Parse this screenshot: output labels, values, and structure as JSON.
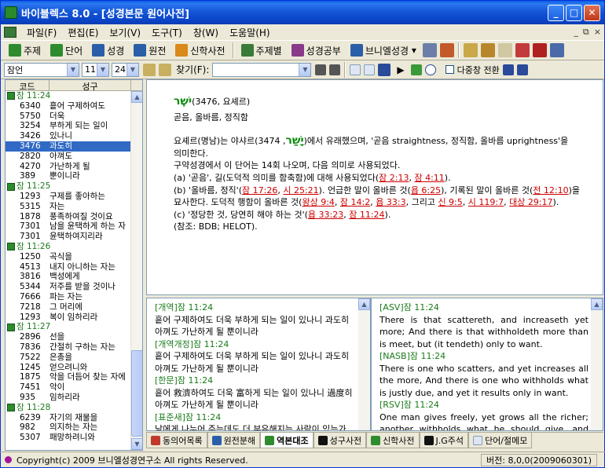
{
  "window": {
    "title": "바이블렉스 8.0 - [성경본문 원어사전]",
    "minimize": "_",
    "maximize": "□",
    "close": "✕"
  },
  "menu": {
    "items": [
      "파일(F)",
      "편집(E)",
      "보기(V)",
      "도구(T)",
      "창(W)",
      "도움말(H)"
    ],
    "mdi_min": "_",
    "mdi_restore": "⧉",
    "mdi_close": "×"
  },
  "toolbar": {
    "items": [
      "주제",
      "단어",
      "성경",
      "원전",
      "신학사전",
      "주제별",
      "성경공부",
      "브니엘성경"
    ]
  },
  "nav": {
    "book": "잠언",
    "chapter": "11",
    "verse": "24",
    "search_label": "찾기(F):",
    "search_value": "",
    "multiwindow_label": "다중창 전환"
  },
  "list": {
    "columns": [
      "코드",
      "성구"
    ],
    "groups": [
      {
        "ref": "잠 11:24",
        "rows": [
          [
            "6340",
            "흩어 구제하여도"
          ],
          [
            "5750",
            "더욱"
          ],
          [
            "3254",
            "부하게 되는 일이"
          ],
          [
            "3426",
            "있나니"
          ],
          [
            "3476",
            "과도히"
          ],
          [
            "2820",
            "아껴도"
          ],
          [
            "4270",
            "가난하게 될"
          ],
          [
            "389",
            "뿐이니라"
          ]
        ]
      },
      {
        "ref": "잠 11:25",
        "rows": [
          [
            "1293",
            "구제를 좋아하는"
          ],
          [
            "5315",
            "자는"
          ],
          [
            "1878",
            "풍족하여질 것이요"
          ],
          [
            "7301",
            "남을 윤택하게 하는 자"
          ],
          [
            "7301",
            "윤택하여지리라"
          ]
        ]
      },
      {
        "ref": "잠 11:26",
        "rows": [
          [
            "1250",
            "곡식을"
          ],
          [
            "4513",
            "내지 아니하는 자는"
          ],
          [
            "3816",
            "백성에게"
          ],
          [
            "5344",
            "저주를 받을 것이나"
          ],
          [
            "7666",
            "파는 자는"
          ],
          [
            "7218",
            "그 머리에"
          ],
          [
            "1293",
            "복이 임하리라"
          ]
        ]
      },
      {
        "ref": "잠 11:27",
        "rows": [
          [
            "2896",
            "선을"
          ],
          [
            "7836",
            "간절히 구하는 자는"
          ],
          [
            "7522",
            "은총을"
          ],
          [
            "1245",
            "얻으려니와"
          ],
          [
            "1875",
            "악을 더듬어 찾는 자에"
          ],
          [
            "7451",
            "악이"
          ],
          [
            "935",
            "임하리라"
          ]
        ]
      },
      {
        "ref": "잠 11:28",
        "rows": [
          [
            "6239",
            "자기의 재물을"
          ],
          [
            "982",
            "의지하는 자는"
          ],
          [
            "5307",
            "패망하려니와"
          ]
        ]
      }
    ],
    "selected": "3476"
  },
  "dict": {
    "heb": "ישֶׁר",
    "entry": "(3476, 요셰르)",
    "meaning": "곧음, 올바름, 정직함",
    "p1a": "요셰르(명남)는 야샤르(",
    "heb2": "יָשַׁר",
    "p1b": ", 3474)에서 유래했으며, '곧음 straightness, 정직함, 올바름 uprightness'을",
    "p1c": "의미한다.",
    "p2": "구약성경에서 이 단어는 14회 나오며, 다음 의미로 사용되었다.",
    "a_pre": "(a) '곧음', 길(도덕적 의미를 함축함)에 대해 사용되었다(",
    "a_r1": "잠 2:13",
    "a_sep": ", ",
    "a_r2": "잠 4:11",
    "a_post": ").",
    "b_pre": "(b) '올바름, 정직'(",
    "b_r1": "잠 17:26",
    "b_s1": ", ",
    "b_r2": "시 25:21",
    "b_mid": "). 언급한 말이 올바른 것(",
    "b_r3": "욥 6:25",
    "b_mid2": "), 기록된 말이 올바른 것(",
    "b_r4": "전 12:10",
    "b_post": ")을",
    "b2_pre": "묘사한다. 도덕적 행함이 올바른 것(",
    "b2_r1": "왕상 9:4",
    "b2_s1": ", ",
    "b2_r2": "잠 14:2",
    "b2_s2": ", ",
    "b2_r3": "욥 33:3",
    "b2_mid": ", 그리고 ",
    "b2_r4": "신 9:5",
    "b2_s3": ", ",
    "b2_r5": "시 119:7",
    "b2_s4": ", ",
    "b2_r6": "대상 29:17",
    "b2_post": ").",
    "c_pre": "(c) '정당한 것, 당연히 해야 하는 것'(",
    "c_r1": "욥 33:23",
    "c_sep": ", ",
    "c_r2": "잠 11:24",
    "c_post": ").",
    "ref": "(참조: BDB; HELOT)."
  },
  "kor": [
    {
      "label": "[개역]잠 11:24",
      "text": "흩어 구제하여도 더욱 부하게 되는 일이 있나니 과도히 아껴도 가난하게 될 뿐이니라"
    },
    {
      "label": "[개역개정]잠 11:24",
      "text": "흩어 구제하여도 더욱 부하게 되는 일이 있나니 과도히 아껴도 가난하게 될 뿐이니라"
    },
    {
      "label": "[한문]잠 11:24",
      "text": "흩어 救濟하여도 더욱 富하게 되는 일이 있나니 過度히 아껴도 가난하게 될 뿐이니라"
    },
    {
      "label": "[표준새]잠 11:24",
      "text": "남에게 나누어 주는데도 더 부유해지는 사람이 있는가 하면"
    }
  ],
  "eng": [
    {
      "label": "[ASV]잠 11:24",
      "text": "There is that scattereth, and increaseth yet more; And there is that withholdeth more than is meet, but (it tendeth) only to want."
    },
    {
      "label": "[NASB]잠 11:24",
      "text": "There is one who scatters, and yet increases all the more, And there is one who withholds what is justly due, and yet it results only in want."
    },
    {
      "label": "[RSV]잠 11:24",
      "text": "One man gives freely, yet grows all the richer; another withholds what he should give, and only"
    }
  ],
  "tabs": [
    "동의어목록",
    "원전분해",
    "역본대조",
    "성구사전",
    "신학사전",
    "J.G주석",
    "단어/절메모"
  ],
  "active_tab": "역본대조",
  "status": {
    "copyright": "Copyright(c) 2009 브니엘성경연구소 All rights Reserved.",
    "version": "버전: 8,0,0(2009060301)"
  }
}
